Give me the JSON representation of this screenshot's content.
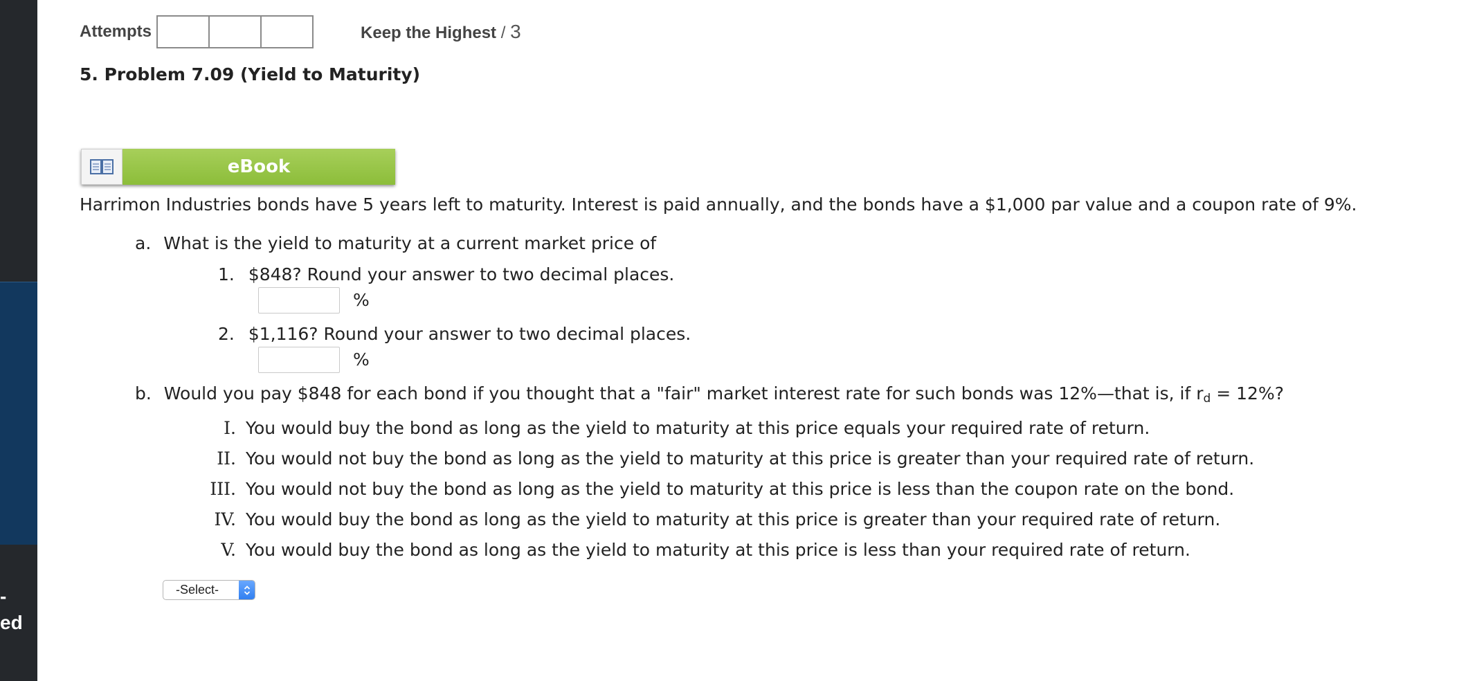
{
  "sidebar": {
    "fragment_1": "-",
    "fragment_2": "ed"
  },
  "attempts": {
    "label": "Attempts",
    "keep_label": "Keep the Highest",
    "slash": "/",
    "max": "3"
  },
  "problem": {
    "title": "5.  Problem 7.09 (Yield to Maturity)"
  },
  "ebook": {
    "label": "eBook"
  },
  "question": {
    "intro": "Harrimon Industries bonds have 5 years left to maturity. Interest is paid annually, and the bonds have a $1,000 par value and a coupon rate of 9%.",
    "part_a": {
      "marker": "a.",
      "text": "What is the yield to maturity at a current market price of",
      "items": [
        {
          "marker": "1.",
          "text": "$848? Round your answer to two decimal places.",
          "unit": "%",
          "value": ""
        },
        {
          "marker": "2.",
          "text": "$1,116? Round your answer to two decimal places.",
          "unit": "%",
          "value": ""
        }
      ]
    },
    "part_b": {
      "marker": "b.",
      "text_before": "Would you pay $848 for each bond if you thought that a \"fair\" market interest rate for such bonds was 12%—that is, if r",
      "subscript": "d",
      "text_after": " = 12%?",
      "options": [
        {
          "numeral": "I.",
          "text": "You would buy the bond as long as the yield to maturity at this price equals your required rate of return."
        },
        {
          "numeral": "II.",
          "text": "You would not buy the bond as long as the yield to maturity at this price is greater than your required rate of return."
        },
        {
          "numeral": "III.",
          "text": "You would not buy the bond as long as the yield to maturity at this price is less than the coupon rate on the bond."
        },
        {
          "numeral": "IV.",
          "text": "You would buy the bond as long as the yield to maturity at this price is greater than your required rate of return."
        },
        {
          "numeral": "V.",
          "text": "You would buy the bond as long as the yield to maturity at this price is less than your required rate of return."
        }
      ],
      "select": {
        "selected": "-Select-"
      }
    }
  },
  "colors": {
    "ebook_green": "#9bc74b",
    "sidebar_dark": "#25282c",
    "sidebar_active": "#12385e",
    "select_arrow_blue": "#3a86f2"
  }
}
